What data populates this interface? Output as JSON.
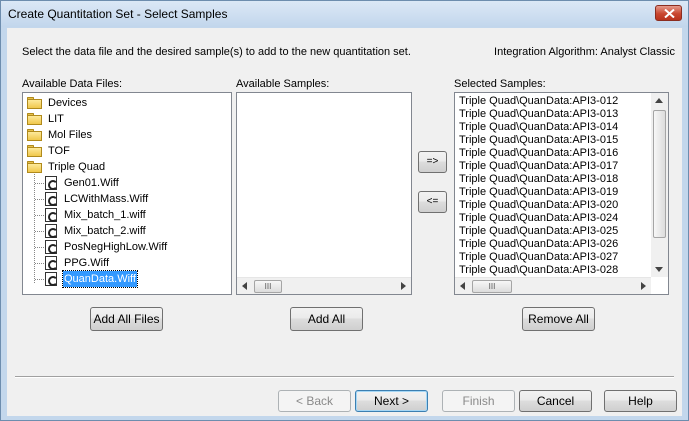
{
  "window": {
    "title": "Create Quantitation Set - Select Samples"
  },
  "instruction": "Select the data file and the desired sample(s) to add to the new quantitation set.",
  "integration_algorithm": "Integration Algorithm: Analyst Classic",
  "data_files": {
    "label": "Available Data Files:",
    "folders": [
      "Devices",
      "LIT",
      "Mol Files",
      "TOF",
      "Triple Quad"
    ],
    "files": [
      "Gen01.Wiff",
      "LCWithMass.Wiff",
      "Mix_batch_1.wiff",
      "Mix_batch_2.wiff",
      "PosNegHighLow.Wiff",
      "PPG.Wiff",
      "QuanData.Wiff"
    ],
    "selected_file": "QuanData.Wiff"
  },
  "samples": {
    "label": "Available Samples:"
  },
  "selected": {
    "label": "Selected Samples:",
    "items": [
      "Triple Quad\\QuanData:API3-012",
      "Triple Quad\\QuanData:API3-013",
      "Triple Quad\\QuanData:API3-014",
      "Triple Quad\\QuanData:API3-015",
      "Triple Quad\\QuanData:API3-016",
      "Triple Quad\\QuanData:API3-017",
      "Triple Quad\\QuanData:API3-018",
      "Triple Quad\\QuanData:API3-019",
      "Triple Quad\\QuanData:API3-020",
      "Triple Quad\\QuanData:API3-024",
      "Triple Quad\\QuanData:API3-025",
      "Triple Quad\\QuanData:API3-026",
      "Triple Quad\\QuanData:API3-027",
      "Triple Quad\\QuanData:API3-028"
    ]
  },
  "buttons": {
    "add": "=>",
    "remove": "<=",
    "add_all_files": "Add All Files",
    "add_all": "Add All",
    "remove_all": "Remove All",
    "back": "< Back",
    "next": "Next >",
    "finish": "Finish",
    "cancel": "Cancel",
    "help": "Help"
  },
  "scroll_thumb_grip": "III",
  "icons": {
    "folder": "folder-icon",
    "file": "wiff-file-icon",
    "close": "close-icon"
  },
  "colors": {
    "selection": "#3399ff",
    "close_button": "#c9472f",
    "title_bar": "#c2d6ec"
  }
}
